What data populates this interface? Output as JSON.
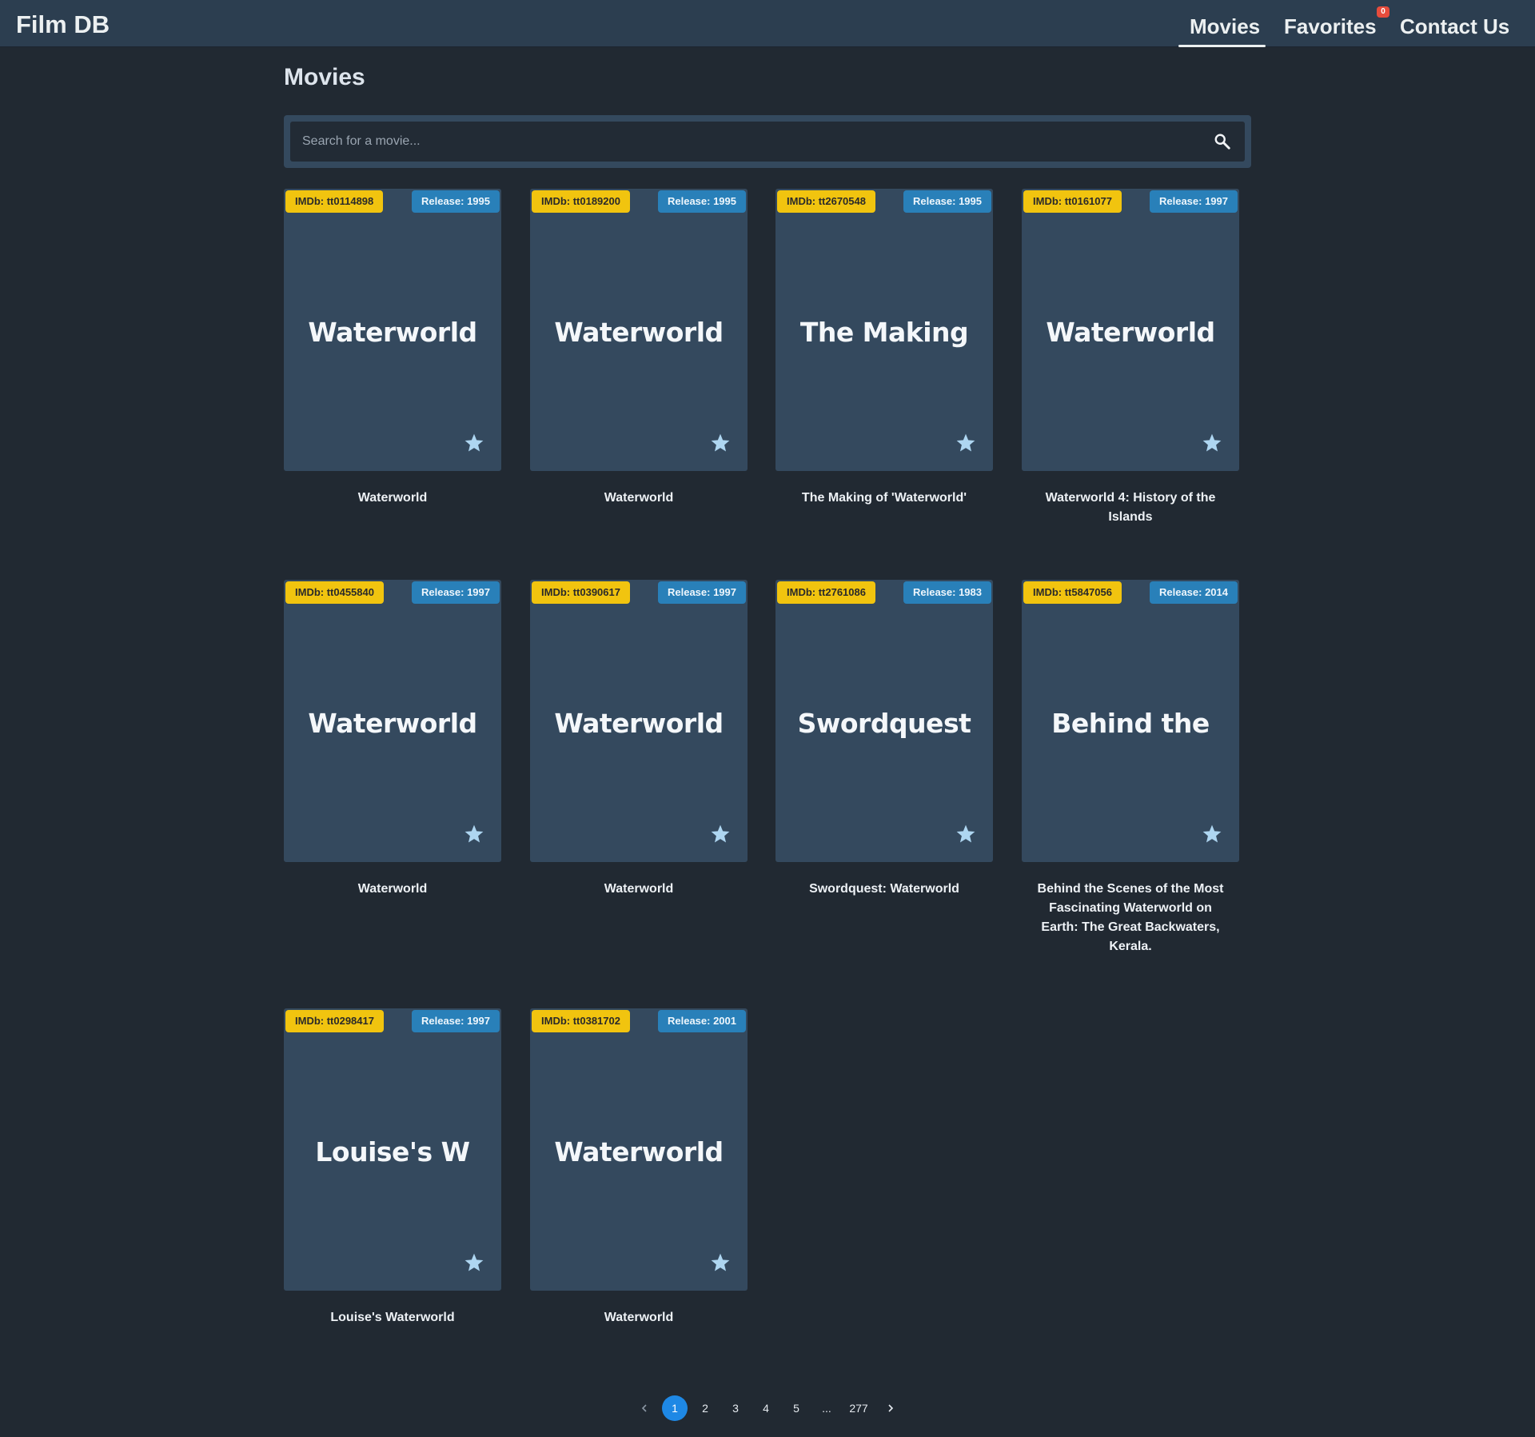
{
  "app": {
    "brand": "Film DB",
    "nav": {
      "movies": "Movies",
      "favorites": "Favorites",
      "favorites_count": "0",
      "contact": "Contact Us"
    }
  },
  "main": {
    "title": "Movies",
    "search": {
      "placeholder": "Search for a movie...",
      "value": ""
    }
  },
  "movies": [
    {
      "imdb": "IMDb: tt0114898",
      "release": "Release: 1995",
      "poster_text": "Waterworld",
      "title": "Waterworld"
    },
    {
      "imdb": "IMDb: tt0189200",
      "release": "Release: 1995",
      "poster_text": "Waterworld",
      "title": "Waterworld"
    },
    {
      "imdb": "IMDb: tt2670548",
      "release": "Release: 1995",
      "poster_text": "The Making",
      "title": "The Making of 'Waterworld'"
    },
    {
      "imdb": "IMDb: tt0161077",
      "release": "Release: 1997",
      "poster_text": "Waterworld",
      "title": "Waterworld 4: History of the Islands"
    },
    {
      "imdb": "IMDb: tt0455840",
      "release": "Release: 1997",
      "poster_text": "Waterworld",
      "title": "Waterworld"
    },
    {
      "imdb": "IMDb: tt0390617",
      "release": "Release: 1997",
      "poster_text": "Waterworld",
      "title": "Waterworld"
    },
    {
      "imdb": "IMDb: tt2761086",
      "release": "Release: 1983",
      "poster_text": "Swordquest",
      "title": "Swordquest: Waterworld"
    },
    {
      "imdb": "IMDb: tt5847056",
      "release": "Release: 2014",
      "poster_text": "Behind the",
      "title": "Behind the Scenes of the Most Fascinating Waterworld on Earth: The Great Backwaters, Kerala."
    },
    {
      "imdb": "IMDb: tt0298417",
      "release": "Release: 1997",
      "poster_text": "Louise's W",
      "title": "Louise's Waterworld"
    },
    {
      "imdb": "IMDb: tt0381702",
      "release": "Release: 2001",
      "poster_text": "Waterworld",
      "title": "Waterworld"
    }
  ],
  "pagination": {
    "pages": [
      "1",
      "2",
      "3",
      "4",
      "5",
      "...",
      "277"
    ],
    "current": "1"
  },
  "colors": {
    "background": "#212932",
    "navbar": "#2c3e50",
    "poster": "#34495e",
    "imdb_badge": "#f1c40f",
    "release_badge": "#2980b9",
    "star": "#aed6f1",
    "active_page": "#1e88e5",
    "fav_badge": "#e74c3c"
  },
  "icons": {
    "search": "search-icon",
    "favorite": "star-icon",
    "prev": "chevron-left-icon",
    "next": "chevron-right-icon"
  }
}
